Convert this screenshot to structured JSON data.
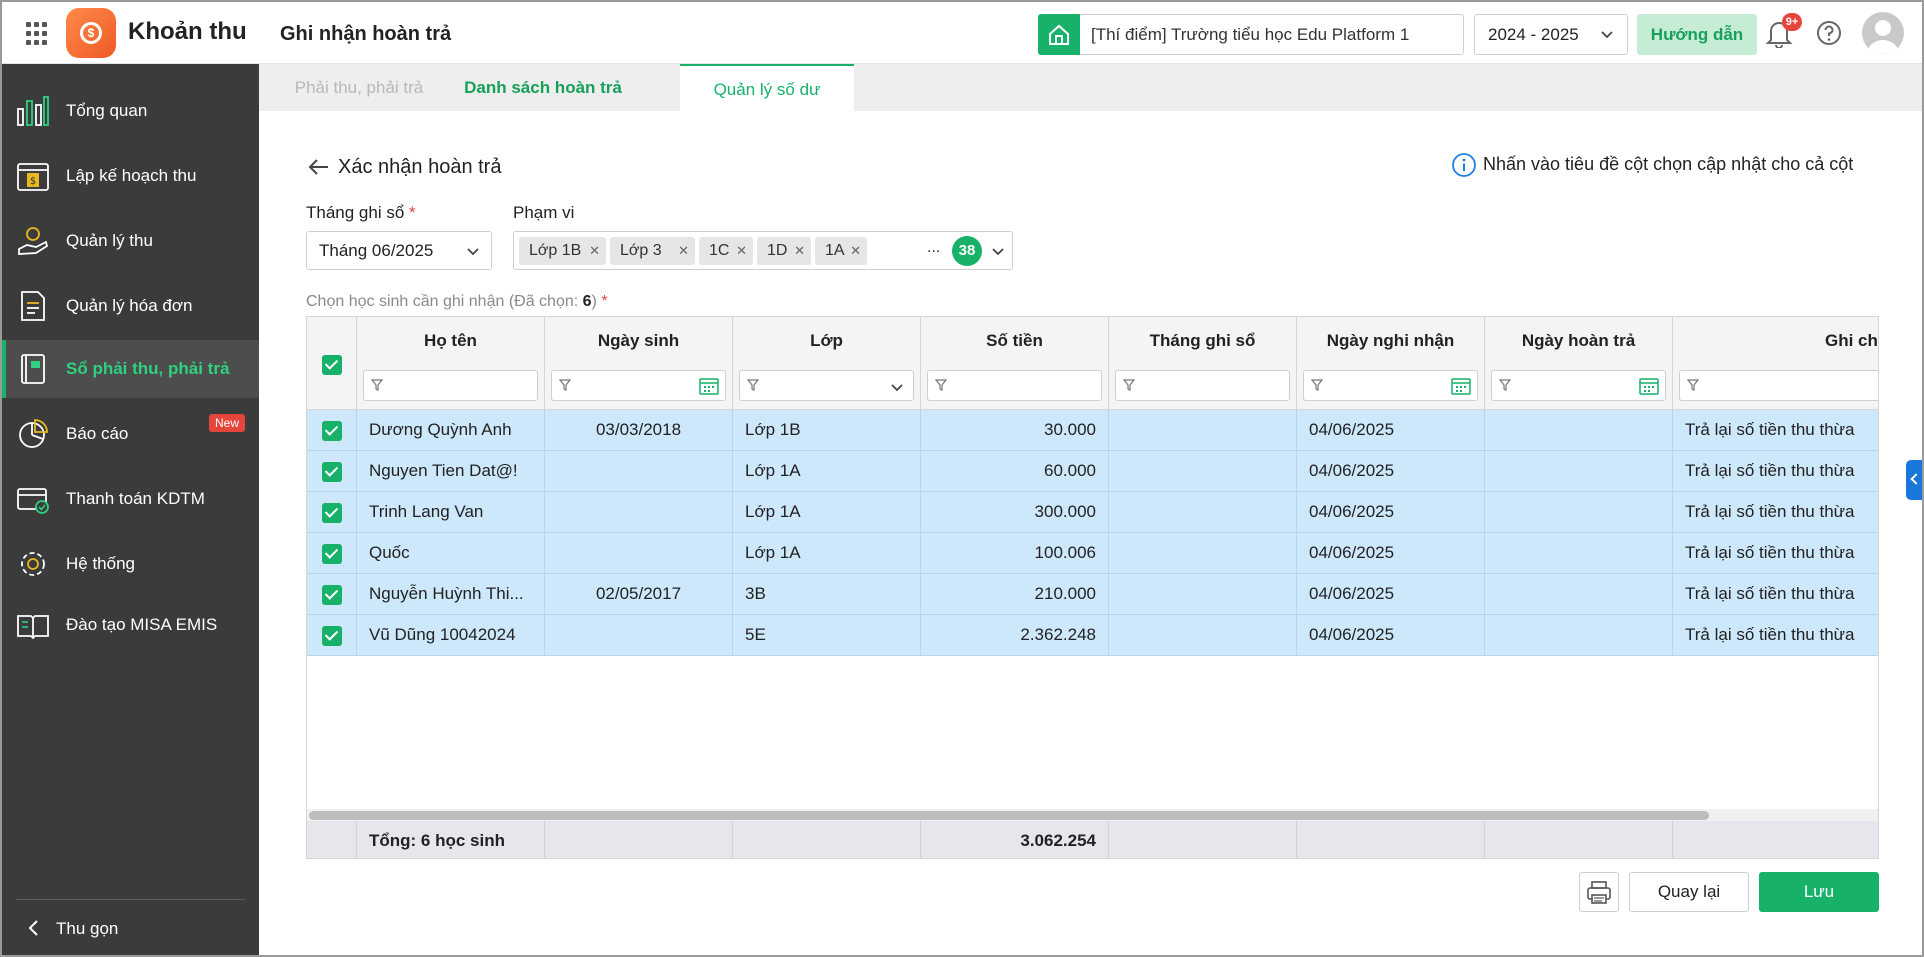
{
  "header": {
    "app_title": "Khoản thu",
    "page_title": "Ghi nhận hoàn trả",
    "school": "[Thí điểm] Trường tiểu học Edu Platform 1",
    "school_year": "2024 - 2025",
    "guide_label": "Hướng dẫn",
    "notification_badge": "9+"
  },
  "sidebar": {
    "items": [
      {
        "label": "Tổng quan",
        "icon": "chart-bars-icon"
      },
      {
        "label": "Lập kế hoạch thu",
        "icon": "calendar-money-icon"
      },
      {
        "label": "Quản lý thu",
        "icon": "hand-coin-icon"
      },
      {
        "label": "Quản lý hóa đơn",
        "icon": "invoice-icon"
      },
      {
        "label": "Sổ phải thu, phải trả",
        "icon": "ledger-book-icon",
        "active": true
      },
      {
        "label": "Báo cáo",
        "icon": "pie-chart-icon"
      },
      {
        "label": "Thanh toán KDTM",
        "icon": "card-payment-icon",
        "badge": "New"
      },
      {
        "label": "Hệ thống",
        "icon": "gear-icon"
      },
      {
        "label": "Đào tạo MISA EMIS",
        "icon": "open-book-icon"
      }
    ],
    "new_badge": "New",
    "collapse_label": "Thu gọn"
  },
  "tabs": [
    {
      "label": "Phải thu, phải trả"
    },
    {
      "label": "Danh sách hoàn trả"
    },
    {
      "label": "Quản lý số dư"
    }
  ],
  "form": {
    "title": "Xác nhận hoàn trả",
    "hint": "Nhấn vào tiêu đề cột chọn cập nhật cho cả cột",
    "month_label": "Tháng ghi sổ",
    "month_value": "Tháng 06/2025",
    "scope_label": "Phạm vi",
    "scope_chips": [
      "Lớp 1B",
      "Lớp 3",
      "1C",
      "1D",
      "1A"
    ],
    "scope_more": "...",
    "scope_count": "38",
    "select_label_prefix": "Chọn học sinh cần ghi nhận (Đã chọn: ",
    "select_count": "6",
    "select_label_suffix": ")"
  },
  "grid": {
    "columns": [
      "Họ tên",
      "Ngày sinh",
      "Lớp",
      "Số tiền",
      "Tháng ghi sổ",
      "Ngày nghi nhận",
      "Ngày hoàn trả",
      "Ghi chú"
    ],
    "rows": [
      {
        "name": "Dương Quỳnh Anh",
        "dob": "03/03/2018",
        "class": "Lớp 1B",
        "amount": "30.000",
        "month": "",
        "record_date": "04/06/2025",
        "refund_date": "",
        "note": "Trả lại số tiền thu thừa"
      },
      {
        "name": "Nguyen Tien Dat@!",
        "dob": "",
        "class": "Lớp 1A",
        "amount": "60.000",
        "month": "",
        "record_date": "04/06/2025",
        "refund_date": "",
        "note": "Trả lại số tiền thu thừa"
      },
      {
        "name": "Trinh Lang Van",
        "dob": "",
        "class": "Lớp 1A",
        "amount": "300.000",
        "month": "",
        "record_date": "04/06/2025",
        "refund_date": "",
        "note": "Trả lại số tiền thu thừa"
      },
      {
        "name": "Quốc",
        "dob": "",
        "class": "Lớp 1A",
        "amount": "100.006",
        "month": "",
        "record_date": "04/06/2025",
        "refund_date": "",
        "note": "Trả lại số tiền thu thừa"
      },
      {
        "name": "Nguyễn Huỳnh Thi...",
        "dob": "02/05/2017",
        "class": "3B",
        "amount": "210.000",
        "month": "",
        "record_date": "04/06/2025",
        "refund_date": "",
        "note": "Trả lại số tiền thu thừa"
      },
      {
        "name": "Vũ Dũng 10042024",
        "dob": "",
        "class": "5E",
        "amount": "2.362.248",
        "month": "",
        "record_date": "04/06/2025",
        "refund_date": "",
        "note": "Trả lại số tiền thu thừa"
      }
    ],
    "total_label": "Tổng: 6 học sinh",
    "total_amount": "3.062.254"
  },
  "actions": {
    "back_label": "Quay lại",
    "save_label": "Lưu"
  },
  "colors": {
    "primary_green": "#17b169",
    "sidebar_bg": "#3b3b3b",
    "selected_row": "#cde7fb",
    "badge_red": "#e6453b"
  }
}
